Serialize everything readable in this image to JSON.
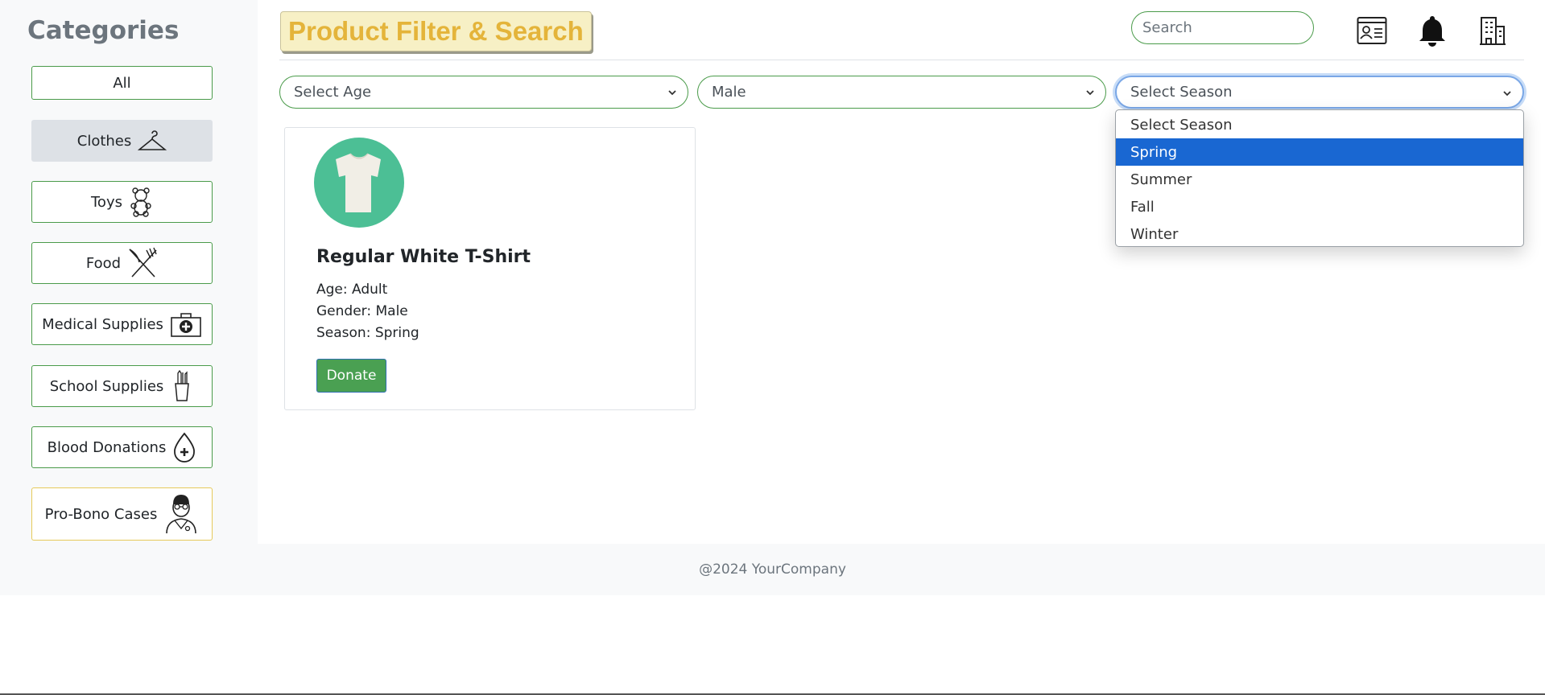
{
  "sidebar": {
    "title": "Categories",
    "items": [
      {
        "label": "All",
        "icon": ""
      },
      {
        "label": "Clothes",
        "icon": "hanger-icon"
      },
      {
        "label": "Toys",
        "icon": "teddy-bear-icon"
      },
      {
        "label": "Food",
        "icon": "fork-knife-icon"
      },
      {
        "label": "Medical Supplies",
        "icon": "first-aid-kit-icon"
      },
      {
        "label": "School Supplies",
        "icon": "pencil-cup-icon"
      },
      {
        "label": "Blood Donations",
        "icon": "blood-drop-icon"
      },
      {
        "label": "Pro-Bono Cases",
        "icon": "doctor-icon"
      }
    ]
  },
  "header": {
    "brand": "Product Filter & Search",
    "search_placeholder": "Search",
    "icons": [
      "id-card-icon",
      "bell-icon",
      "building-icon"
    ]
  },
  "filters": {
    "age": "Select Age",
    "gender": "Male",
    "season": "Select Season",
    "season_options": [
      "Select Season",
      "Spring",
      "Summer",
      "Fall",
      "Winter"
    ],
    "season_highlighted": "Spring"
  },
  "product": {
    "name": "Regular White T-Shirt",
    "age": "Age: Adult",
    "gender": "Gender: Male",
    "season": "Season: Spring",
    "button": "Donate"
  },
  "footer": {
    "text": "@2024 YourCompany"
  },
  "colors": {
    "accent_green": "#4a9b4a",
    "brand_yellow": "#e4b43a",
    "highlight_blue": "#1967d2",
    "product_circle": "#4cbf95"
  }
}
